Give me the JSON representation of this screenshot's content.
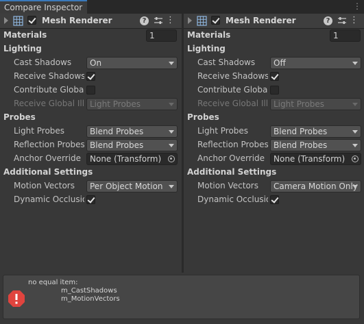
{
  "window": {
    "tab_title": "Compare Inspector"
  },
  "panels": [
    {
      "component_title": "Mesh Renderer",
      "enabled": true,
      "materials": {
        "label": "Materials",
        "value": "1"
      },
      "lighting": {
        "label": "Lighting",
        "cast_shadows": {
          "label": "Cast Shadows",
          "value": "On"
        },
        "receive_shadows": {
          "label": "Receive Shadows",
          "checked": true
        },
        "contribute_gi": {
          "label": "Contribute Global I",
          "checked": false
        },
        "receive_gi": {
          "label": "Receive Global Illu",
          "value": "Light Probes"
        }
      },
      "probes": {
        "label": "Probes",
        "light_probes": {
          "label": "Light Probes",
          "value": "Blend Probes"
        },
        "reflection_probes": {
          "label": "Reflection Probes",
          "value": "Blend Probes"
        },
        "anchor_override": {
          "label": "Anchor Override",
          "value": "None (Transform)"
        }
      },
      "additional": {
        "label": "Additional Settings",
        "motion_vectors": {
          "label": "Motion Vectors",
          "value": "Per Object Motion"
        },
        "dynamic_occlusion": {
          "label": "Dynamic Occlusion",
          "checked": true
        }
      }
    },
    {
      "component_title": "Mesh Renderer",
      "enabled": true,
      "materials": {
        "label": "Materials",
        "value": "1"
      },
      "lighting": {
        "label": "Lighting",
        "cast_shadows": {
          "label": "Cast Shadows",
          "value": "Off"
        },
        "receive_shadows": {
          "label": "Receive Shadows",
          "checked": true
        },
        "contribute_gi": {
          "label": "Contribute Global I",
          "checked": false
        },
        "receive_gi": {
          "label": "Receive Global Illu",
          "value": "Light Probes"
        }
      },
      "probes": {
        "label": "Probes",
        "light_probes": {
          "label": "Light Probes",
          "value": "Blend Probes"
        },
        "reflection_probes": {
          "label": "Reflection Probes",
          "value": "Blend Probes"
        },
        "anchor_override": {
          "label": "Anchor Override",
          "value": "None (Transform)"
        }
      },
      "additional": {
        "label": "Additional Settings",
        "motion_vectors": {
          "label": "Motion Vectors",
          "value": "Camera Motion Only"
        },
        "dynamic_occlusion": {
          "label": "Dynamic Occlusion",
          "checked": true
        }
      }
    }
  ],
  "help_box": {
    "icon": "error-icon",
    "heading": "no equal item:",
    "items": [
      "m_CastShadows",
      "m_MotionVectors"
    ]
  }
}
